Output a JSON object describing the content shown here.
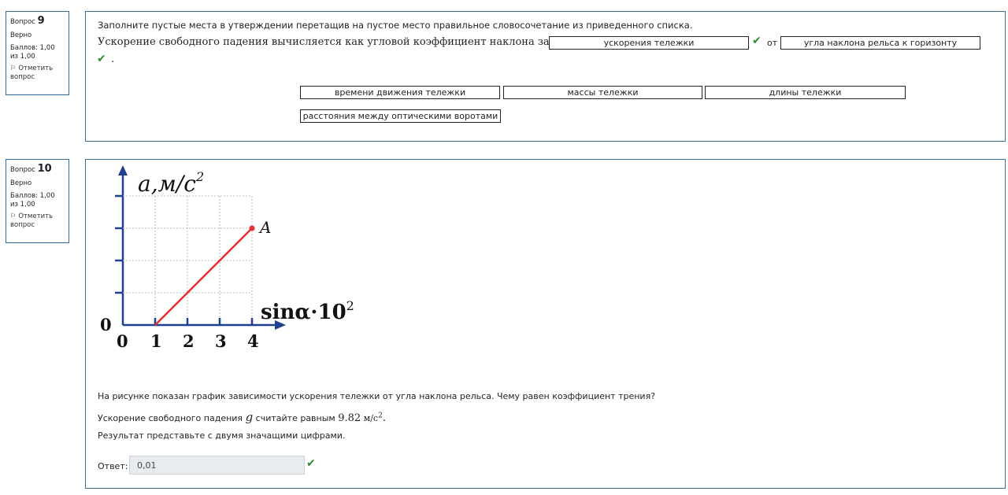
{
  "q9": {
    "number_label": "Вопрос",
    "number": "9",
    "status": "Верно",
    "grade": "Баллов: 1,00 из 1,00",
    "flag": "Отметить вопрос",
    "instruction": "Заполните пустые места в утверждении перетащив на пустое место  правильное словосочетание из приведенного списка.",
    "sentence": "Ускорение свободного падения вычисляется как угловой коэффициент наклона зависимости",
    "blank1": "ускорения тележки",
    "connector": "от",
    "blank2": "угла наклона рельса к горизонту",
    "period": ".",
    "choices": [
      "времени движения тележки",
      "массы тележки",
      "длины тележки",
      "расстояния между оптическими воротами"
    ]
  },
  "q10": {
    "number_label": "Вопрос",
    "number": "10",
    "status": "Верно",
    "grade": "Баллов: 1,00 из 1,00",
    "flag": "Отметить вопрос",
    "text1": "На рисунке показан график зависимости ускорения тележки от угла наклона рельса. Чему равен коэффициент трения?",
    "text2_before": "Ускорение свободного падения",
    "text2_var": "g",
    "text2_mid": "считайте равным",
    "text2_value": "9.82",
    "text2_unit": "м/с",
    "text2_exp": "2",
    "text2_end": ".",
    "text3": "Результат представьте с двумя значащими цифрами.",
    "answer_label": "Ответ:",
    "answer_value": "0,01"
  },
  "chart_data": {
    "type": "line",
    "ylabel": "a,м/с",
    "ylabel_exp": "2",
    "xlabel": "sinα·10",
    "xlabel_exp": "2",
    "x_ticks": [
      "0",
      "1",
      "2",
      "3",
      "4"
    ],
    "y_origin_label": "0",
    "xlim": [
      0,
      4
    ],
    "ylim_grid_lines": 4,
    "grid": true,
    "series": [
      {
        "x": [
          1,
          4
        ],
        "y": [
          0,
          3
        ],
        "color": "#e8302c"
      }
    ],
    "point_label": "A"
  },
  "colors": {
    "check": "#2d8a2d",
    "border": "#3a6f9a",
    "line": "#e8302c"
  }
}
